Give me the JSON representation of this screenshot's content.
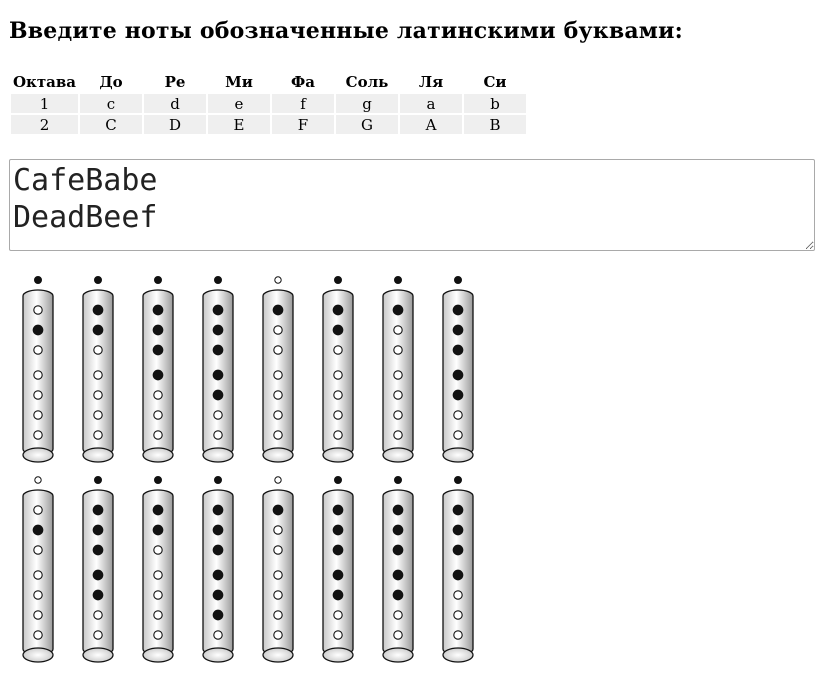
{
  "heading": "Введите ноты обозначенные латинскими буквами:",
  "note_table": {
    "headers": [
      "Октава",
      "До",
      "Ре",
      "Ми",
      "Фа",
      "Соль",
      "Ля",
      "Си"
    ],
    "rows": [
      [
        "1",
        "c",
        "d",
        "e",
        "f",
        "g",
        "a",
        "b"
      ],
      [
        "2",
        "C",
        "D",
        "E",
        "F",
        "G",
        "A",
        "B"
      ]
    ]
  },
  "input": {
    "value": "CafeBabe\nDeadBeef"
  },
  "fingering": {
    "rows": [
      [
        {
          "note": "C",
          "top": 1,
          "holes": [
            0,
            1,
            0,
            0,
            0,
            0,
            0
          ]
        },
        {
          "note": "a",
          "top": 1,
          "holes": [
            1,
            1,
            0,
            0,
            0,
            0,
            0
          ]
        },
        {
          "note": "f",
          "top": 1,
          "holes": [
            1,
            1,
            1,
            1,
            0,
            0,
            0
          ]
        },
        {
          "note": "e",
          "top": 1,
          "holes": [
            1,
            1,
            1,
            1,
            1,
            0,
            0
          ]
        },
        {
          "note": "B",
          "top": 0,
          "holes": [
            1,
            0,
            0,
            0,
            0,
            0,
            0
          ]
        },
        {
          "note": "a",
          "top": 1,
          "holes": [
            1,
            1,
            0,
            0,
            0,
            0,
            0
          ]
        },
        {
          "note": "b",
          "top": 1,
          "holes": [
            1,
            0,
            0,
            0,
            0,
            0,
            0
          ]
        },
        {
          "note": "e",
          "top": 1,
          "holes": [
            1,
            1,
            1,
            1,
            1,
            0,
            0
          ]
        }
      ],
      [
        {
          "note": "D",
          "top": 0,
          "holes": [
            0,
            1,
            0,
            0,
            0,
            0,
            0
          ]
        },
        {
          "note": "e",
          "top": 1,
          "holes": [
            1,
            1,
            1,
            1,
            1,
            0,
            0
          ]
        },
        {
          "note": "a",
          "top": 1,
          "holes": [
            1,
            1,
            0,
            0,
            0,
            0,
            0
          ]
        },
        {
          "note": "d",
          "top": 1,
          "holes": [
            1,
            1,
            1,
            1,
            1,
            1,
            0
          ]
        },
        {
          "note": "B",
          "top": 0,
          "holes": [
            1,
            0,
            0,
            0,
            0,
            0,
            0
          ]
        },
        {
          "note": "e",
          "top": 1,
          "holes": [
            1,
            1,
            1,
            1,
            1,
            0,
            0
          ]
        },
        {
          "note": "e",
          "top": 1,
          "holes": [
            1,
            1,
            1,
            1,
            1,
            0,
            0
          ]
        },
        {
          "note": "f",
          "top": 1,
          "holes": [
            1,
            1,
            1,
            1,
            0,
            0,
            0
          ]
        }
      ]
    ]
  }
}
